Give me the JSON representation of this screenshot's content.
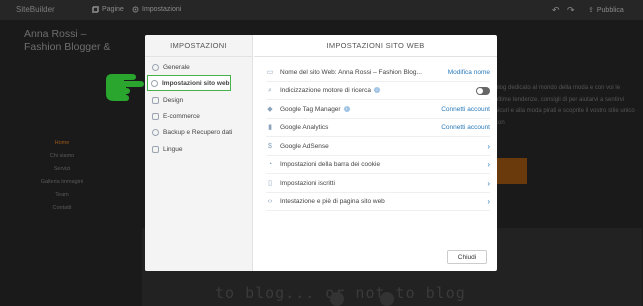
{
  "topbar": {
    "brand": "SiteBuilder",
    "pages_label": "Pagine",
    "settings_label": "Impostazioni",
    "publish_label": "Pubblica"
  },
  "background": {
    "site_title": "Anna Rossi – Fashion Blogger &",
    "nav": [
      "Home",
      "Chi siamo",
      "Servizi",
      "Galleria immagini",
      "Team",
      "Contatti"
    ],
    "right_text": "blog dedicato al mondo della moda e con voi le ultime tendenze, consigli di per aiutarvi a sentirvi sicuri e alla moda pirati e scoprite il vostro stile unico con",
    "bottom_text": "to blog... or not to blog"
  },
  "modal": {
    "left_title": "IMPOSTAZIONI",
    "right_title": "IMPOSTAZIONI SITO WEB",
    "menu": [
      {
        "label": "Generale",
        "icon": "gear-icon"
      },
      {
        "label": "Impostazioni sito web",
        "icon": "globe-icon",
        "selected": true
      },
      {
        "label": "Design",
        "icon": "palette-icon"
      },
      {
        "label": "E-commerce",
        "icon": "cart-icon"
      },
      {
        "label": "Backup e Recupero dati",
        "icon": "refresh-icon"
      },
      {
        "label": "Lingue",
        "icon": "flag-icon"
      }
    ],
    "rows": [
      {
        "label": "Nome del sito Web:",
        "value": "Anna Rossi – Fashion Blog...",
        "action": "Modifica nome",
        "icon": "browser-icon"
      },
      {
        "label": "Indicizzazione motore di ricerca",
        "icon": "search-icon",
        "toggle": "off"
      },
      {
        "label": "Google Tag Manager",
        "icon": "tag-icon",
        "action": "Connetti account"
      },
      {
        "label": "Google Analytics",
        "icon": "bar-chart-icon",
        "action": "Connetti account"
      },
      {
        "label": "Google AdSense",
        "icon": "dollar-icon"
      },
      {
        "label": "Impostazioni della barra dei cookie",
        "icon": "cookie-icon"
      },
      {
        "label": "Impostazioni iscritti",
        "icon": "subscriber-icon"
      },
      {
        "label": "Intestazione e piè di pagina sito web",
        "icon": "code-icon"
      }
    ],
    "close_label": "Chiudi"
  }
}
